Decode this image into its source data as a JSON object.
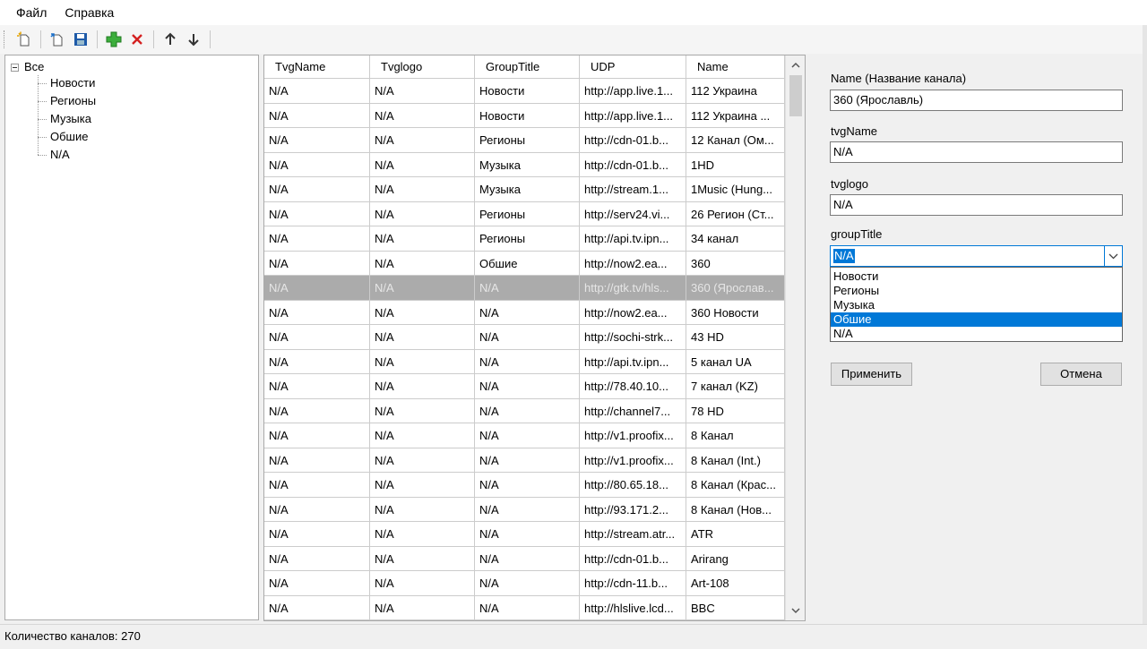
{
  "menu": {
    "file": "Файл",
    "help": "Справка"
  },
  "tree": {
    "root": "Все",
    "children": [
      "Новости",
      "Регионы",
      "Музыка",
      "Обшие",
      "N/A"
    ]
  },
  "grid": {
    "columns": [
      "TvgName",
      "Tvglogo",
      "GroupTitle",
      "UDP",
      "Name"
    ],
    "rows": [
      [
        "N/A",
        "N/A",
        "Новости",
        "http://app.live.1...",
        "112 Украина"
      ],
      [
        "N/A",
        "N/A",
        "Новости",
        "http://app.live.1...",
        "112 Украина ..."
      ],
      [
        "N/A",
        "N/A",
        "Регионы",
        "http://cdn-01.b...",
        "12 Канал (Ом..."
      ],
      [
        "N/A",
        "N/A",
        "Музыка",
        "http://cdn-01.b...",
        "1HD"
      ],
      [
        "N/A",
        "N/A",
        "Музыка",
        "http://stream.1...",
        "1Music (Hung..."
      ],
      [
        "N/A",
        "N/A",
        "Регионы",
        "http://serv24.vi...",
        "26 Регион (Ст..."
      ],
      [
        "N/A",
        "N/A",
        "Регионы",
        "http://api.tv.ipn...",
        "34 канал"
      ],
      [
        "N/A",
        "N/A",
        "Обшие",
        "http://now2.ea...",
        "360"
      ],
      [
        "N/A",
        "N/A",
        "N/A",
        "http://gtk.tv/hls...",
        "360 (Ярослав..."
      ],
      [
        "N/A",
        "N/A",
        "N/A",
        "http://now2.ea...",
        "360 Новости"
      ],
      [
        "N/A",
        "N/A",
        "N/A",
        "http://sochi-strk...",
        "43 HD"
      ],
      [
        "N/A",
        "N/A",
        "N/A",
        "http://api.tv.ipn...",
        "5 канал UA"
      ],
      [
        "N/A",
        "N/A",
        "N/A",
        "http://78.40.10...",
        "7 канал (KZ)"
      ],
      [
        "N/A",
        "N/A",
        "N/A",
        "http://channel7...",
        "78 HD"
      ],
      [
        "N/A",
        "N/A",
        "N/A",
        "http://v1.proofix...",
        "8 Канал"
      ],
      [
        "N/A",
        "N/A",
        "N/A",
        "http://v1.proofix...",
        "8 Канал (Int.)"
      ],
      [
        "N/A",
        "N/A",
        "N/A",
        "http://80.65.18...",
        "8 Канал (Крас..."
      ],
      [
        "N/A",
        "N/A",
        "N/A",
        "http://93.171.2...",
        "8 Канал (Нов..."
      ],
      [
        "N/A",
        "N/A",
        "N/A",
        "http://stream.atr...",
        "ATR"
      ],
      [
        "N/A",
        "N/A",
        "N/A",
        "http://cdn-01.b...",
        "Arirang"
      ],
      [
        "N/A",
        "N/A",
        "N/A",
        "http://cdn-11.b...",
        "Art-108"
      ],
      [
        "N/A",
        "N/A",
        "N/A",
        "http://hlslive.lcd...",
        "BBC"
      ]
    ],
    "selected_row": 8
  },
  "form": {
    "name_label": "Name (Название канала)",
    "name_value": "360 (Ярославль)",
    "tvgname_label": "tvgName",
    "tvgname_value": "N/A",
    "tvglogo_label": "tvglogo",
    "tvglogo_value": "N/A",
    "grouptitle_label": "groupTitle",
    "grouptitle_value": "N/A",
    "options": [
      "Новости",
      "Регионы",
      "Музыка",
      "Обшие",
      "N/A"
    ],
    "highlighted_option": "Обшие",
    "apply_label": "Применить",
    "cancel_label": "Отмена"
  },
  "status": {
    "text": "Количество каналов: 270"
  },
  "colors": {
    "accent": "#0078d7",
    "selected_row": "#ababab",
    "add_green": "#2e9e2e",
    "delete_red": "#d22"
  },
  "icons": [
    "new-file-icon",
    "open-icon",
    "save-icon",
    "add-icon",
    "delete-icon",
    "arrow-up-icon",
    "arrow-down-icon"
  ]
}
